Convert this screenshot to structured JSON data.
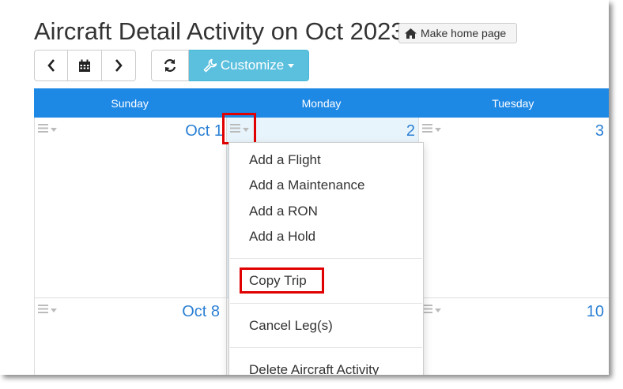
{
  "page": {
    "title": "Aircraft Detail Activity on Oct 2023",
    "home_button": "Make home page"
  },
  "toolbar": {
    "prev_icon": "chevron-left-icon",
    "calendar_icon": "calendar-icon",
    "next_icon": "chevron-right-icon",
    "refresh_icon": "refresh-icon",
    "customize_label": "Customize"
  },
  "calendar": {
    "days": [
      "Sunday",
      "Monday",
      "Tuesday"
    ],
    "week1": [
      "Oct 1",
      "2",
      "3"
    ],
    "week2": [
      "Oct 8",
      "",
      "10"
    ]
  },
  "menu": {
    "items": [
      "Add a Flight",
      "Add a Maintenance",
      "Add a RON",
      "Add a Hold"
    ],
    "copy_trip": "Copy Trip",
    "cancel_legs": "Cancel Leg(s)",
    "delete": "Delete Aircraft Activity"
  },
  "colors": {
    "header_blue": "#1e88e5",
    "customize_bg": "#5bc0de",
    "date_blue": "#2a7fd4",
    "highlight_red": "#e00000",
    "today_bg": "#e8f4fb"
  }
}
